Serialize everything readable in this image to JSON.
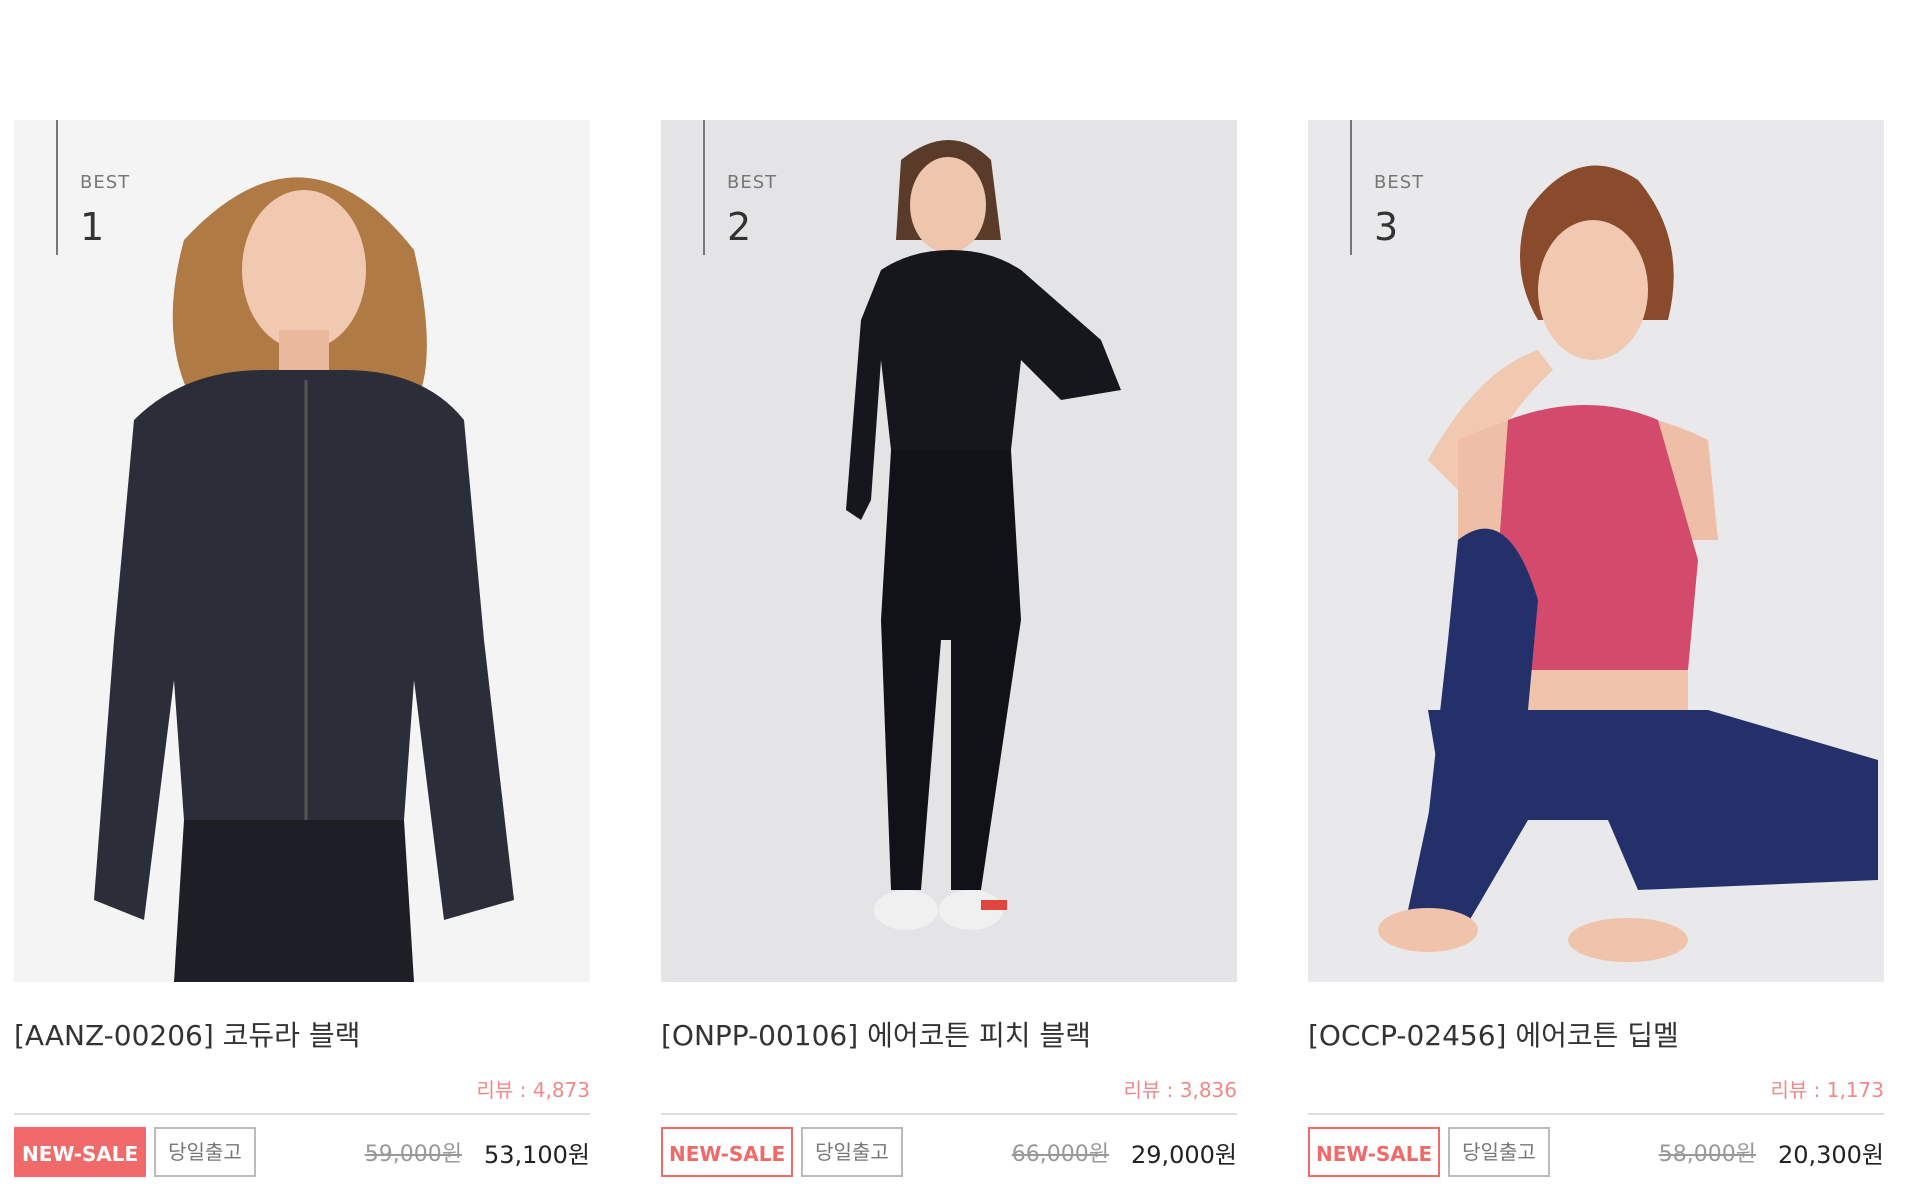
{
  "products": [
    {
      "rank_label": "BEST",
      "rank": "1",
      "title": "[AANZ-00206] 코듀라 블랙",
      "reviews": "리뷰 : 4,873",
      "badge_sale": "NEW-SALE",
      "badge_sale_style": "filled",
      "badge_ship": "당일출고",
      "original_price": "59,000원",
      "price": "53,100원"
    },
    {
      "rank_label": "BEST",
      "rank": "2",
      "title": "[ONPP-00106] 에어코튼 피치 블랙",
      "reviews": "리뷰 : 3,836",
      "badge_sale": "NEW-SALE",
      "badge_sale_style": "outline",
      "badge_ship": "당일출고",
      "original_price": "66,000원",
      "price": "29,000원"
    },
    {
      "rank_label": "BEST",
      "rank": "3",
      "title": "[OCCP-02456] 에어코튼 딥멜",
      "reviews": "리뷰 : 1,173",
      "badge_sale": "NEW-SALE",
      "badge_sale_style": "outline",
      "badge_ship": "당일출고",
      "original_price": "58,000원",
      "price": "20,300원"
    }
  ],
  "colors": {
    "accent": "#f06a6a",
    "review": "#f08a8a",
    "photo_bg_1": "#f4f4f4",
    "photo_bg_2": "#e4e4e6",
    "photo_bg_3": "#e9e9eb"
  }
}
